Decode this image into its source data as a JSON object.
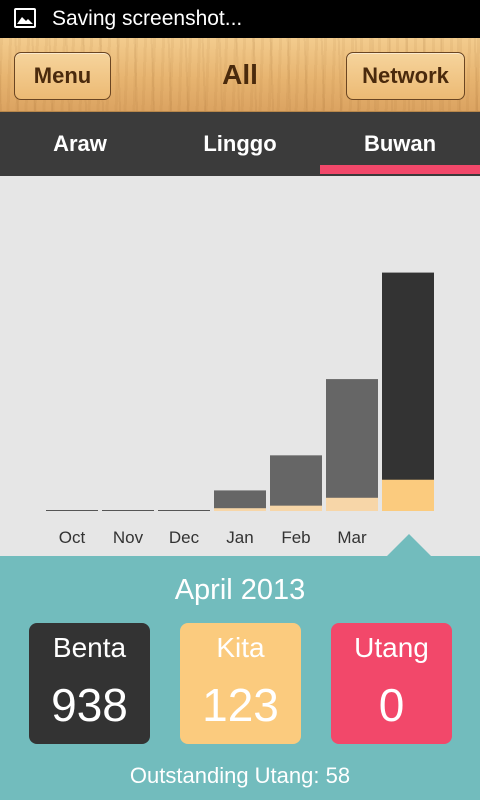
{
  "status_bar": {
    "text": "Saving screenshot...",
    "icon": "image-icon"
  },
  "header": {
    "menu_label": "Menu",
    "title": "All",
    "network_label": "Network"
  },
  "tabs": [
    {
      "label": "Araw",
      "active": false
    },
    {
      "label": "Linggo",
      "active": false
    },
    {
      "label": "Buwan",
      "active": true
    }
  ],
  "colors": {
    "accent": "#f2486a",
    "teal": "#72bcbd",
    "dark": "#333333",
    "bar_past": "#666666",
    "bar_current": "#333333",
    "kita": "#fbcb7e",
    "kita_bar": "#f7d6a8"
  },
  "chart_data": {
    "type": "bar",
    "categories": [
      "Oct",
      "Nov",
      "Dec",
      "Jan",
      "Feb",
      "Mar",
      "Apr"
    ],
    "series": [
      {
        "values": [
          0,
          0,
          0,
          81,
          219,
          519,
          938
        ]
      },
      {
        "values": [
          0,
          0,
          0,
          11,
          21,
          52,
          123
        ]
      }
    ],
    "ylim": [
      0,
      1200
    ],
    "highlighted": "Apr"
  },
  "summary": {
    "month": "April 2013",
    "benta_label": "Benta",
    "benta_value": "938",
    "kita_label": "Kita",
    "kita_value": "123",
    "utang_label": "Utang",
    "utang_value": "0",
    "outstanding": "Outstanding Utang: 58"
  }
}
